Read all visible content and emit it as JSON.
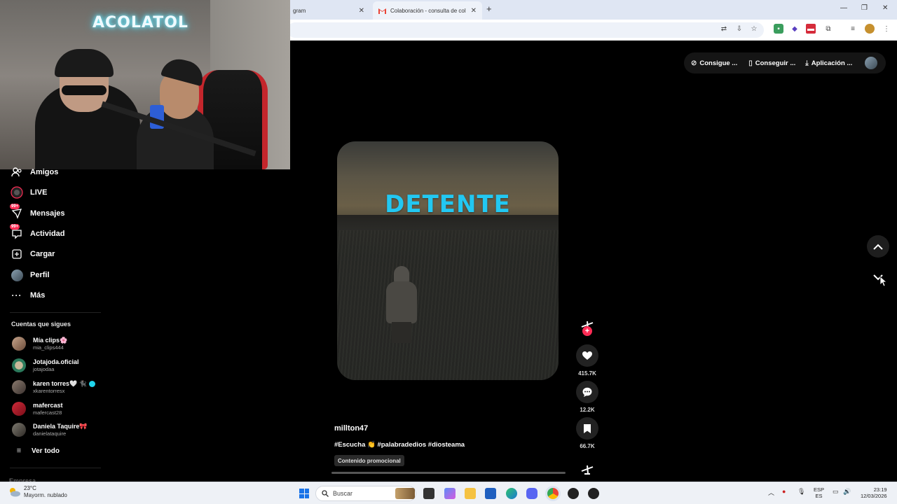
{
  "browser": {
    "tabs": [
      {
        "label": "gram"
      },
      {
        "label": "Colaboración - consulta de col"
      }
    ],
    "new_tab": "+",
    "window_controls": {
      "minimize": "—",
      "maximize": "❐",
      "close": "✕"
    }
  },
  "webcam": {
    "neon_sign": "ACOLATOL"
  },
  "sidebar": {
    "nav": [
      {
        "label": "Amigos",
        "icon": "friends-icon"
      },
      {
        "label": "LIVE",
        "icon": "live-icon"
      },
      {
        "label": "Mensajes",
        "icon": "messages-icon",
        "badge": "99+"
      },
      {
        "label": "Actividad",
        "icon": "activity-icon",
        "badge": "99+"
      },
      {
        "label": "Cargar",
        "icon": "upload-icon"
      },
      {
        "label": "Perfil",
        "icon": "profile-avatar"
      },
      {
        "label": "Más",
        "icon": "more-icon"
      }
    ],
    "following_title": "Cuentas que sigues",
    "following": [
      {
        "name": "Mía clips🌸",
        "user": "mia_clips444"
      },
      {
        "name": "Jotajoda.oficial",
        "user": "jotajodaa"
      },
      {
        "name": "karen torres🤍 🐈‍⬛",
        "user": "xkarentorresx",
        "verified": true
      },
      {
        "name": "mafercast",
        "user": "mafercast28"
      },
      {
        "name": "Daniela Taquire🎀",
        "user": "danielataquire"
      }
    ],
    "see_all": "Ver todo",
    "footer": "Empresa"
  },
  "top_menu": {
    "items": [
      {
        "label": "Consigue ...",
        "icon": "coin-icon"
      },
      {
        "label": "Conseguir ...",
        "icon": "phone-icon"
      },
      {
        "label": "Aplicación ...",
        "icon": "download-icon"
      }
    ]
  },
  "video": {
    "overlay_text": "DETENTE",
    "author": "millton47",
    "caption": "#Escucha 👏 #palabradedios #diosteama",
    "promo_label": "Contenido promocional"
  },
  "actions": {
    "likes": "415.7K",
    "comments": "12.2K",
    "saves": "66.7K"
  },
  "taskbar": {
    "weather_temp": "23°C",
    "weather_desc": "Mayorm. nublado",
    "search_placeholder": "Buscar",
    "lang_top": "ESP",
    "lang_bottom": "ES",
    "time": "23:19",
    "date": "12/03/2026"
  },
  "colors": {
    "accent": "#fe2c55",
    "overlay_text": "#22c8f2",
    "verified": "#20d5ec"
  }
}
